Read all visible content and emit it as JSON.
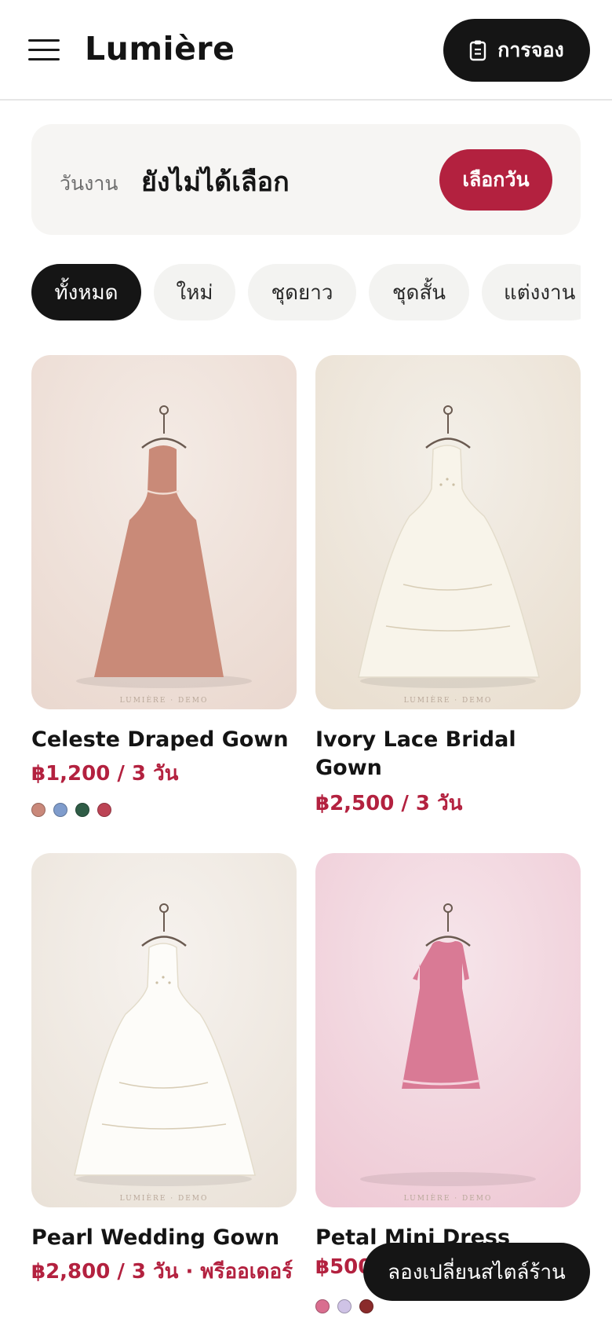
{
  "header": {
    "brand": "Lumière",
    "menu_icon": "hamburger-menu-icon",
    "booking_label": "การจอง",
    "booking_icon": "clipboard-icon"
  },
  "event_date": {
    "label": "วันงาน",
    "value": "ยังไม่ได้เลือก",
    "button_label": "เลือกวัน"
  },
  "filters": {
    "chips": [
      {
        "label": "ทั้งหมด",
        "active": true
      },
      {
        "label": "ใหม่",
        "active": false
      },
      {
        "label": "ชุดยาว",
        "active": false
      },
      {
        "label": "ชุดสั้น",
        "active": false
      },
      {
        "label": "แต่งงาน",
        "active": false
      }
    ]
  },
  "products": [
    {
      "name": "Celeste Draped Gown",
      "price": "฿1,200 / 3 วัน",
      "watermark": "LUMIÈRE · DEMO",
      "image_bg": [
        "#f4ebe5",
        "#ead8cf"
      ],
      "dress_color": "#c98a78",
      "swatches": [
        "#c9887a",
        "#7f9ccc",
        "#2f5c46",
        "#bc4455"
      ]
    },
    {
      "name": "Ivory Lace Bridal Gown",
      "price": "฿2,500 / 3 วัน",
      "watermark": "LUMIÈRE · DEMO",
      "image_bg": [
        "#f3efe8",
        "#e9decf"
      ],
      "dress_color": "#f8f4ea",
      "swatches": []
    },
    {
      "name": "Pearl Wedding Gown",
      "price": "฿2,800 / 3 วัน · พรีออเดอร์",
      "watermark": "LUMIÈRE · DEMO",
      "image_bg": [
        "#f6f2ee",
        "#eae2d8"
      ],
      "dress_color": "#fdfcf9",
      "swatches": []
    },
    {
      "name": "Petal Mini Dress",
      "price": "฿500",
      "watermark": "LUMIÈRE · DEMO",
      "image_bg": [
        "#f6e5ea",
        "#eec8d4"
      ],
      "dress_color": "#d97a95",
      "swatches": [
        "#d96e8f",
        "#cfc3e6",
        "#8a2b2b"
      ]
    }
  ],
  "floating_button": {
    "label": "ลองเปลี่ยนสไตล์ร้าน"
  }
}
